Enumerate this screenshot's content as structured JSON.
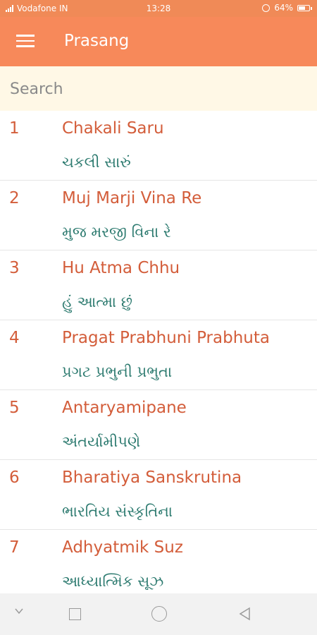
{
  "status_bar": {
    "carrier": "Vodafone IN",
    "time": "13:28",
    "battery": "64%",
    "battery_level": 0.64
  },
  "app_bar": {
    "title": "Prasang",
    "menu_icon": "hamburger-menu-icon"
  },
  "search": {
    "placeholder": "Search",
    "value": ""
  },
  "items": [
    {
      "number": "1",
      "title": "Chakali Saru",
      "subtitle": "ચકલી સારું"
    },
    {
      "number": "2",
      "title": "Muj Marji Vina Re",
      "subtitle": "મુજ મરજી વિના રે"
    },
    {
      "number": "3",
      "title": "Hu Atma Chhu",
      "subtitle": "હું આત્મા છું"
    },
    {
      "number": "4",
      "title": "Pragat Prabhuni Prabhuta",
      "subtitle": "પ્રગટ પ્રભુની પ્રભુતા"
    },
    {
      "number": "5",
      "title": "Antaryamipane",
      "subtitle": "અંતર્યામીપણે"
    },
    {
      "number": "6",
      "title": "Bharatiya Sanskrutina",
      "subtitle": "ભારતિય સંસ્કૃતિના"
    },
    {
      "number": "7",
      "title": "Adhyatmik Suz",
      "subtitle": "આધ્યાત્મિક સૂઝ"
    }
  ],
  "colors": {
    "app_bar": "#f7895a",
    "title_text": "#d35d3a",
    "subtitle_text": "#2c7a6f",
    "search_bg": "#fff8e6"
  }
}
